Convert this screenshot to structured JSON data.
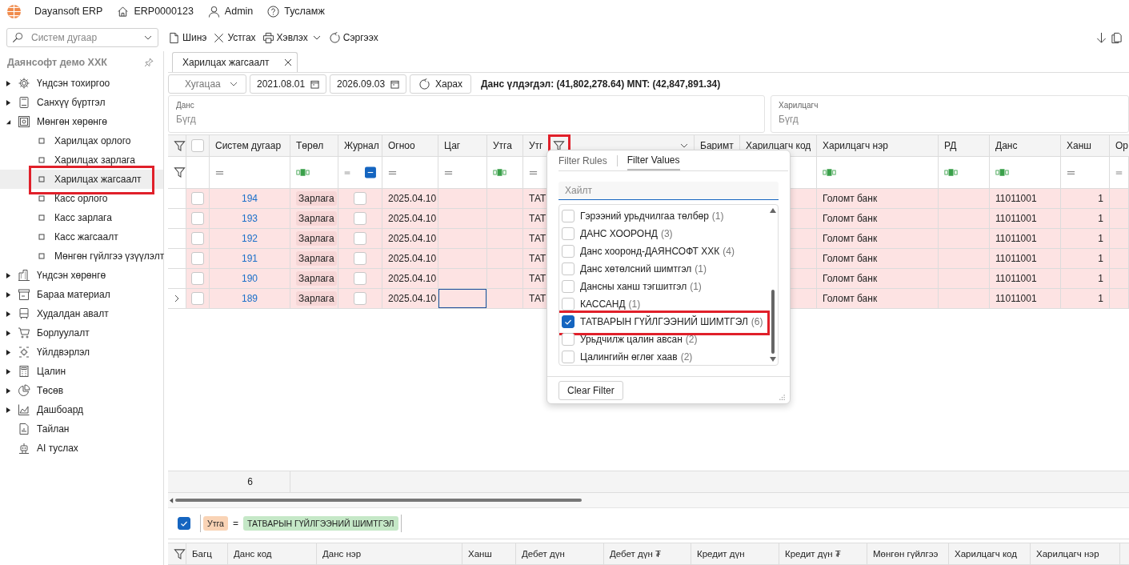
{
  "app": {
    "name": "Dayansoft ERP",
    "database": "ERP0000123",
    "user": "Admin",
    "help": "Тусламж"
  },
  "search": {
    "placeholder": "Систем дугаар"
  },
  "toolbar": [
    {
      "label": "Шинэ",
      "kind": "new",
      "has_menu": false
    },
    {
      "label": "Устгах",
      "kind": "delete",
      "has_menu": false
    },
    {
      "label": "Хэвлэх",
      "kind": "print",
      "has_menu": true
    },
    {
      "label": "Сэргээх",
      "kind": "refresh",
      "has_menu": false
    }
  ],
  "sidebar": {
    "title": "Даянсофт демо ХХК",
    "items": [
      {
        "label": "Үндсэн тохиргоо",
        "kind": "gear",
        "expandable": true,
        "expanded": false
      },
      {
        "label": "Санхүү бүртгэл",
        "kind": "book",
        "expandable": true,
        "expanded": false
      },
      {
        "label": "Мөнгөн хөрөнгө",
        "kind": "safe",
        "expandable": true,
        "expanded": true,
        "children": [
          {
            "label": "Харилцах орлого",
            "selected": false,
            "annotated": false
          },
          {
            "label": "Харилцах зарлага",
            "selected": false,
            "annotated": false
          },
          {
            "label": "Харилцах жагсаалт",
            "selected": true,
            "annotated": true
          },
          {
            "label": "Касс орлого",
            "selected": false,
            "annotated": false
          },
          {
            "label": "Касс зарлага",
            "selected": false,
            "annotated": false
          },
          {
            "label": "Касс жагсаалт",
            "selected": false,
            "annotated": false
          },
          {
            "label": "Мөнгөн гүйлгээ үзүүлэлт",
            "selected": false,
            "annotated": false
          }
        ]
      },
      {
        "label": "Үндсэн хөрөнгө",
        "kind": "building",
        "expandable": true,
        "expanded": false
      },
      {
        "label": "Бараа материал",
        "kind": "box",
        "expandable": true,
        "expanded": false
      },
      {
        "label": "Худалдан авалт",
        "kind": "bus",
        "expandable": true,
        "expanded": false
      },
      {
        "label": "Борлуулалт",
        "kind": "cart",
        "expandable": true,
        "expanded": false
      },
      {
        "label": "Үйлдвэрлэл",
        "kind": "factory",
        "expandable": true,
        "expanded": false
      },
      {
        "label": "Цалин",
        "kind": "calculator",
        "expandable": true,
        "expanded": false
      },
      {
        "label": "Төсөв",
        "kind": "pie",
        "expandable": true,
        "expanded": false
      },
      {
        "label": "Дашбоард",
        "kind": "chart",
        "expandable": true,
        "expanded": false
      },
      {
        "label": "Тайлан",
        "kind": "report",
        "expandable": false
      },
      {
        "label": "AI туслах",
        "kind": "robot",
        "expandable": false
      }
    ]
  },
  "tabs": [
    {
      "label": "Харилцах жагсаалт",
      "selected": true
    }
  ],
  "filter_bar": {
    "period": "Хугацаа",
    "date_from": "2021.08.01",
    "date_to": "2026.09.03",
    "view_button": "Харах",
    "balance": "Данс үлдэгдэл: (41,802,278.64) MNT: (42,847,891.34)"
  },
  "lookups": [
    {
      "label": "Данс",
      "placeholder": "Бүгд"
    },
    {
      "label": "Харилцагч",
      "placeholder": "Бүгд"
    }
  ],
  "grid": {
    "select_all": false,
    "columns": [
      {
        "label": "Систем дугаар",
        "kind": "link",
        "filter_open": false
      },
      {
        "label": "Төрөл",
        "kind": "tag",
        "filter_open": false
      },
      {
        "label": "Журнал",
        "kind": "checkbox",
        "filter_open": false
      },
      {
        "label": "Огноо",
        "kind": "text",
        "filter_open": false
      },
      {
        "label": "Цаг",
        "kind": "text",
        "filter_open": false
      },
      {
        "label": "Утга",
        "kind": "text",
        "filter_open": false
      },
      {
        "label": "Утг",
        "kind": "text",
        "filter_open": true,
        "annotated": true
      },
      {
        "label": "Баримт",
        "kind": "text",
        "filter_open": false
      },
      {
        "label": "Харилцагч код",
        "kind": "text",
        "filter_open": false
      },
      {
        "label": "Харилцагч нэр",
        "kind": "text",
        "filter_open": false
      },
      {
        "label": "РД",
        "kind": "text",
        "filter_open": false
      },
      {
        "label": "Данс",
        "kind": "text",
        "filter_open": false
      },
      {
        "label": "Ханш",
        "kind": "number",
        "filter_open": false
      },
      {
        "label": "Ор",
        "kind": "text",
        "filter_open": false
      }
    ],
    "filter_row": [
      {
        "kind": "equals"
      },
      {
        "kind": "text"
      },
      {
        "kind": "check",
        "indeterminate": true
      },
      {
        "kind": "equals"
      },
      {
        "kind": "equals"
      },
      {
        "kind": "text"
      },
      {
        "kind": "equals"
      },
      {
        "kind": "covered"
      },
      {
        "kind": "blank"
      },
      {
        "kind": "text"
      },
      {
        "kind": "text"
      },
      {
        "kind": "text"
      },
      {
        "kind": "equals"
      },
      {
        "kind": "equals"
      }
    ],
    "rows": [
      {
        "checked": false,
        "current": false,
        "cells": [
          "194",
          "Зарлага",
          false,
          "2025.04.10",
          null,
          null,
          "ТАТ",
          null,
          null,
          "Голомт банк",
          null,
          "11011001",
          "1",
          null
        ]
      },
      {
        "checked": false,
        "current": false,
        "cells": [
          "193",
          "Зарлага",
          false,
          "2025.04.10",
          null,
          null,
          "ТАТ",
          null,
          null,
          "Голомт банк",
          null,
          "11011001",
          "1",
          null
        ]
      },
      {
        "checked": false,
        "current": false,
        "cells": [
          "192",
          "Зарлага",
          false,
          "2025.04.10",
          null,
          null,
          "ТАТ",
          null,
          null,
          "Голомт банк",
          null,
          "11011001",
          "1",
          null
        ]
      },
      {
        "checked": false,
        "current": false,
        "cells": [
          "191",
          "Зарлага",
          false,
          "2025.04.10",
          null,
          null,
          "ТАТ",
          null,
          null,
          "Голомт банк",
          null,
          "11011001",
          "1",
          null
        ]
      },
      {
        "checked": false,
        "current": false,
        "cells": [
          "190",
          "Зарлага",
          false,
          "2025.04.10",
          null,
          null,
          "ТАТ",
          null,
          null,
          "Голомт банк",
          null,
          "11011001",
          "1",
          null
        ]
      },
      {
        "checked": false,
        "current": true,
        "cells": [
          "189",
          "Зарлага",
          false,
          "2025.04.10",
          null,
          null,
          "ТАТ",
          null,
          null,
          "Голомт банк",
          null,
          "11011001",
          "1",
          null
        ]
      }
    ],
    "footer_count": "6"
  },
  "filter_popup": {
    "tabs": [
      {
        "label": "Filter Rules",
        "selected": false
      },
      {
        "label": "Filter Values",
        "selected": true
      }
    ],
    "search_placeholder": "Хайлт",
    "values": [
      {
        "label": "Гэрээний урьдчилгаа төлбөр",
        "count": "(1)",
        "checked": false,
        "annotated": false
      },
      {
        "label": "ДАНС ХООРОНД",
        "count": "(3)",
        "checked": false,
        "annotated": false
      },
      {
        "label": "Данс хооронд-ДАЯНСОФТ ХХК",
        "count": "(4)",
        "checked": false,
        "annotated": false
      },
      {
        "label": "Данс хөтөлсний шимтгэл",
        "count": "(1)",
        "checked": false,
        "annotated": false
      },
      {
        "label": "Дансны ханш тэгшитгэл",
        "count": "(1)",
        "checked": false,
        "annotated": false
      },
      {
        "label": "КАССАНД",
        "count": "(1)",
        "checked": false,
        "annotated": false
      },
      {
        "label": "ТАТВАРЫН ГҮЙЛГЭЭНИЙ ШИМТГЭЛ",
        "count": "(6)",
        "checked": true,
        "annotated": true
      },
      {
        "label": "Урьдчилж цалин авсан",
        "count": "(2)",
        "checked": false,
        "annotated": false
      },
      {
        "label": "Цалингийн өглөг хаав",
        "count": "(2)",
        "checked": false,
        "annotated": false
      }
    ],
    "clear_button": "Clear Filter"
  },
  "filter_panel": {
    "enabled": true,
    "field": "Утга",
    "operator": "=",
    "value": "ТАТВАРЫН ГҮЙЛГЭЭНИЙ ШИМТГЭЛ"
  },
  "detail_grid": {
    "columns": [
      "Багц",
      "Данс код",
      "Данс нэр",
      "Ханш",
      "Дебет дүн",
      "Дебет дүн ₮",
      "Кредит дүн",
      "Кредит дүн ₮",
      "Мөнгөн гүйлгээ",
      "Харилцагч код",
      "Харилцагч нэр"
    ]
  }
}
